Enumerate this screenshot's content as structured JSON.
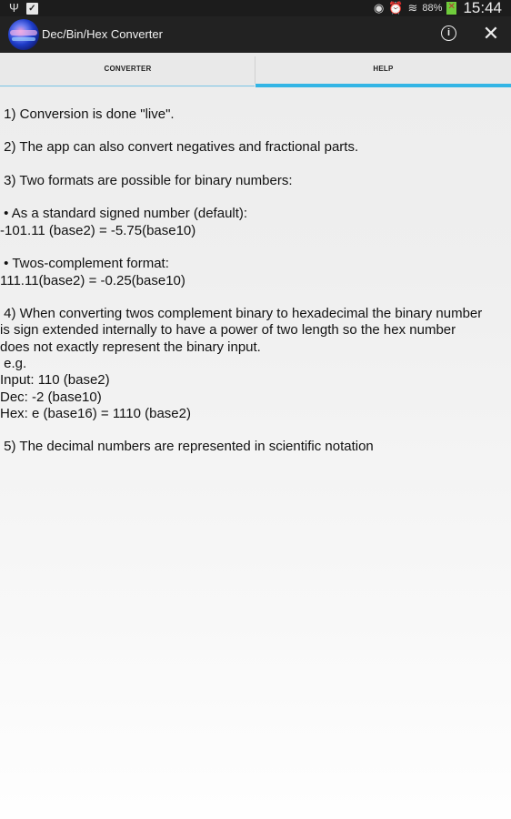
{
  "status_bar": {
    "icons": [
      "usb-icon",
      "task-check-icon",
      "eye-icon",
      "alarm-icon",
      "wifi-icon",
      "battery-charging-icon"
    ],
    "battery_percent": "88%",
    "time": "15:44"
  },
  "action_bar": {
    "app_icon": "app-logo-icon",
    "title": "Dec/Bin/Hex Converter",
    "info_icon": "ⓘ",
    "close_icon": "✕"
  },
  "tabs": [
    {
      "label": "CONVERTER",
      "selected": false
    },
    {
      "label": "HELP",
      "selected": true
    }
  ],
  "help": {
    "lines": [
      " 1) Conversion is done \"live\".",
      " 2) The app can also convert negatives and fractional parts.",
      " 3) Two formats are possible for binary numbers:",
      " • As a standard signed number (default):",
      "-101.11 (base2) = -5.75(base10)",
      " • Twos-complement format:",
      "111.11(base2) = -0.25(base10)",
      " 4) When converting twos complement binary to hexadecimal the binary number",
      "is sign extended internally to have a power of two length so the hex number",
      "does not exactly represent the binary input.",
      " e.g.",
      "Input: 110 (base2)",
      "Dec: -2 (base10)",
      "Hex: e (base16) = 1110 (base2)",
      " 5) The decimal numbers are represented in scientific notation"
    ]
  }
}
